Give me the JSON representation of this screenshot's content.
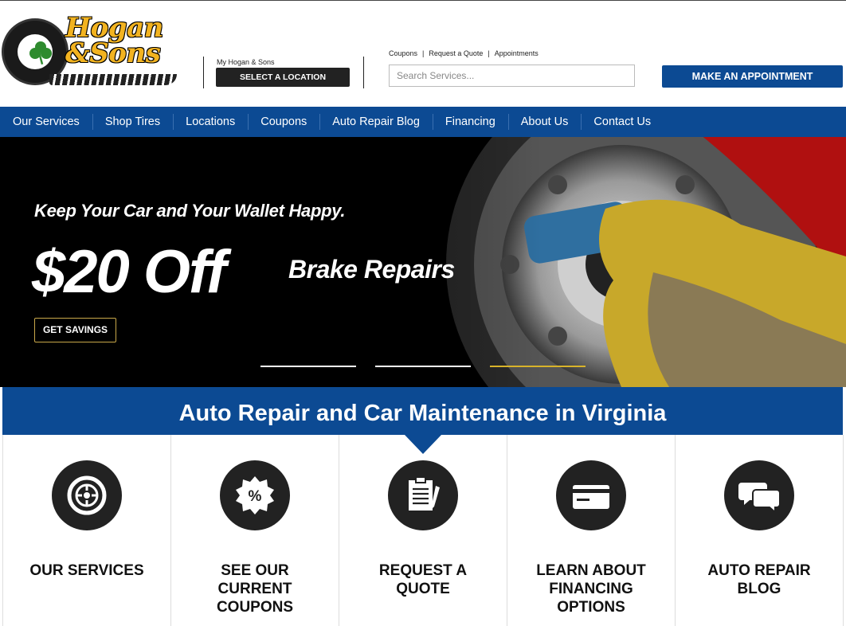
{
  "brand": {
    "name": "Hogan\n&Sons"
  },
  "location": {
    "label": "My Hogan & Sons",
    "button": "SELECT A LOCATION"
  },
  "top_links": [
    "Coupons",
    "Request a Quote",
    "Appointments"
  ],
  "search": {
    "placeholder": "Search Services..."
  },
  "appointment_button": "MAKE AN APPOINTMENT",
  "nav": [
    "Our Services",
    "Shop Tires",
    "Locations",
    "Coupons",
    "Auto Repair Blog",
    "Financing",
    "About Us",
    "Contact Us"
  ],
  "hero": {
    "tagline": "Keep Your Car and Your Wallet Happy.",
    "offer": "$20 Off",
    "offer_sub": "Brake Repairs",
    "cta": "GET SAVINGS",
    "slides": 3,
    "active_slide": 3,
    "active_color": "#d8b32a"
  },
  "section": {
    "title": "Auto Repair and Car Maintenance in Virginia",
    "cards": [
      {
        "label": "OUR SERVICES",
        "icon": "tire-icon"
      },
      {
        "label": "SEE OUR CURRENT COUPONS",
        "icon": "percent-badge-icon"
      },
      {
        "label": "REQUEST A QUOTE",
        "icon": "clipboard-icon"
      },
      {
        "label": "LEARN ABOUT FINANCING OPTIONS",
        "icon": "credit-card-icon"
      },
      {
        "label": "AUTO REPAIR BLOG",
        "icon": "chat-bubbles-icon"
      }
    ]
  },
  "colors": {
    "primary": "#0c4a93",
    "accent": "#f2b320",
    "dark": "#222222"
  }
}
